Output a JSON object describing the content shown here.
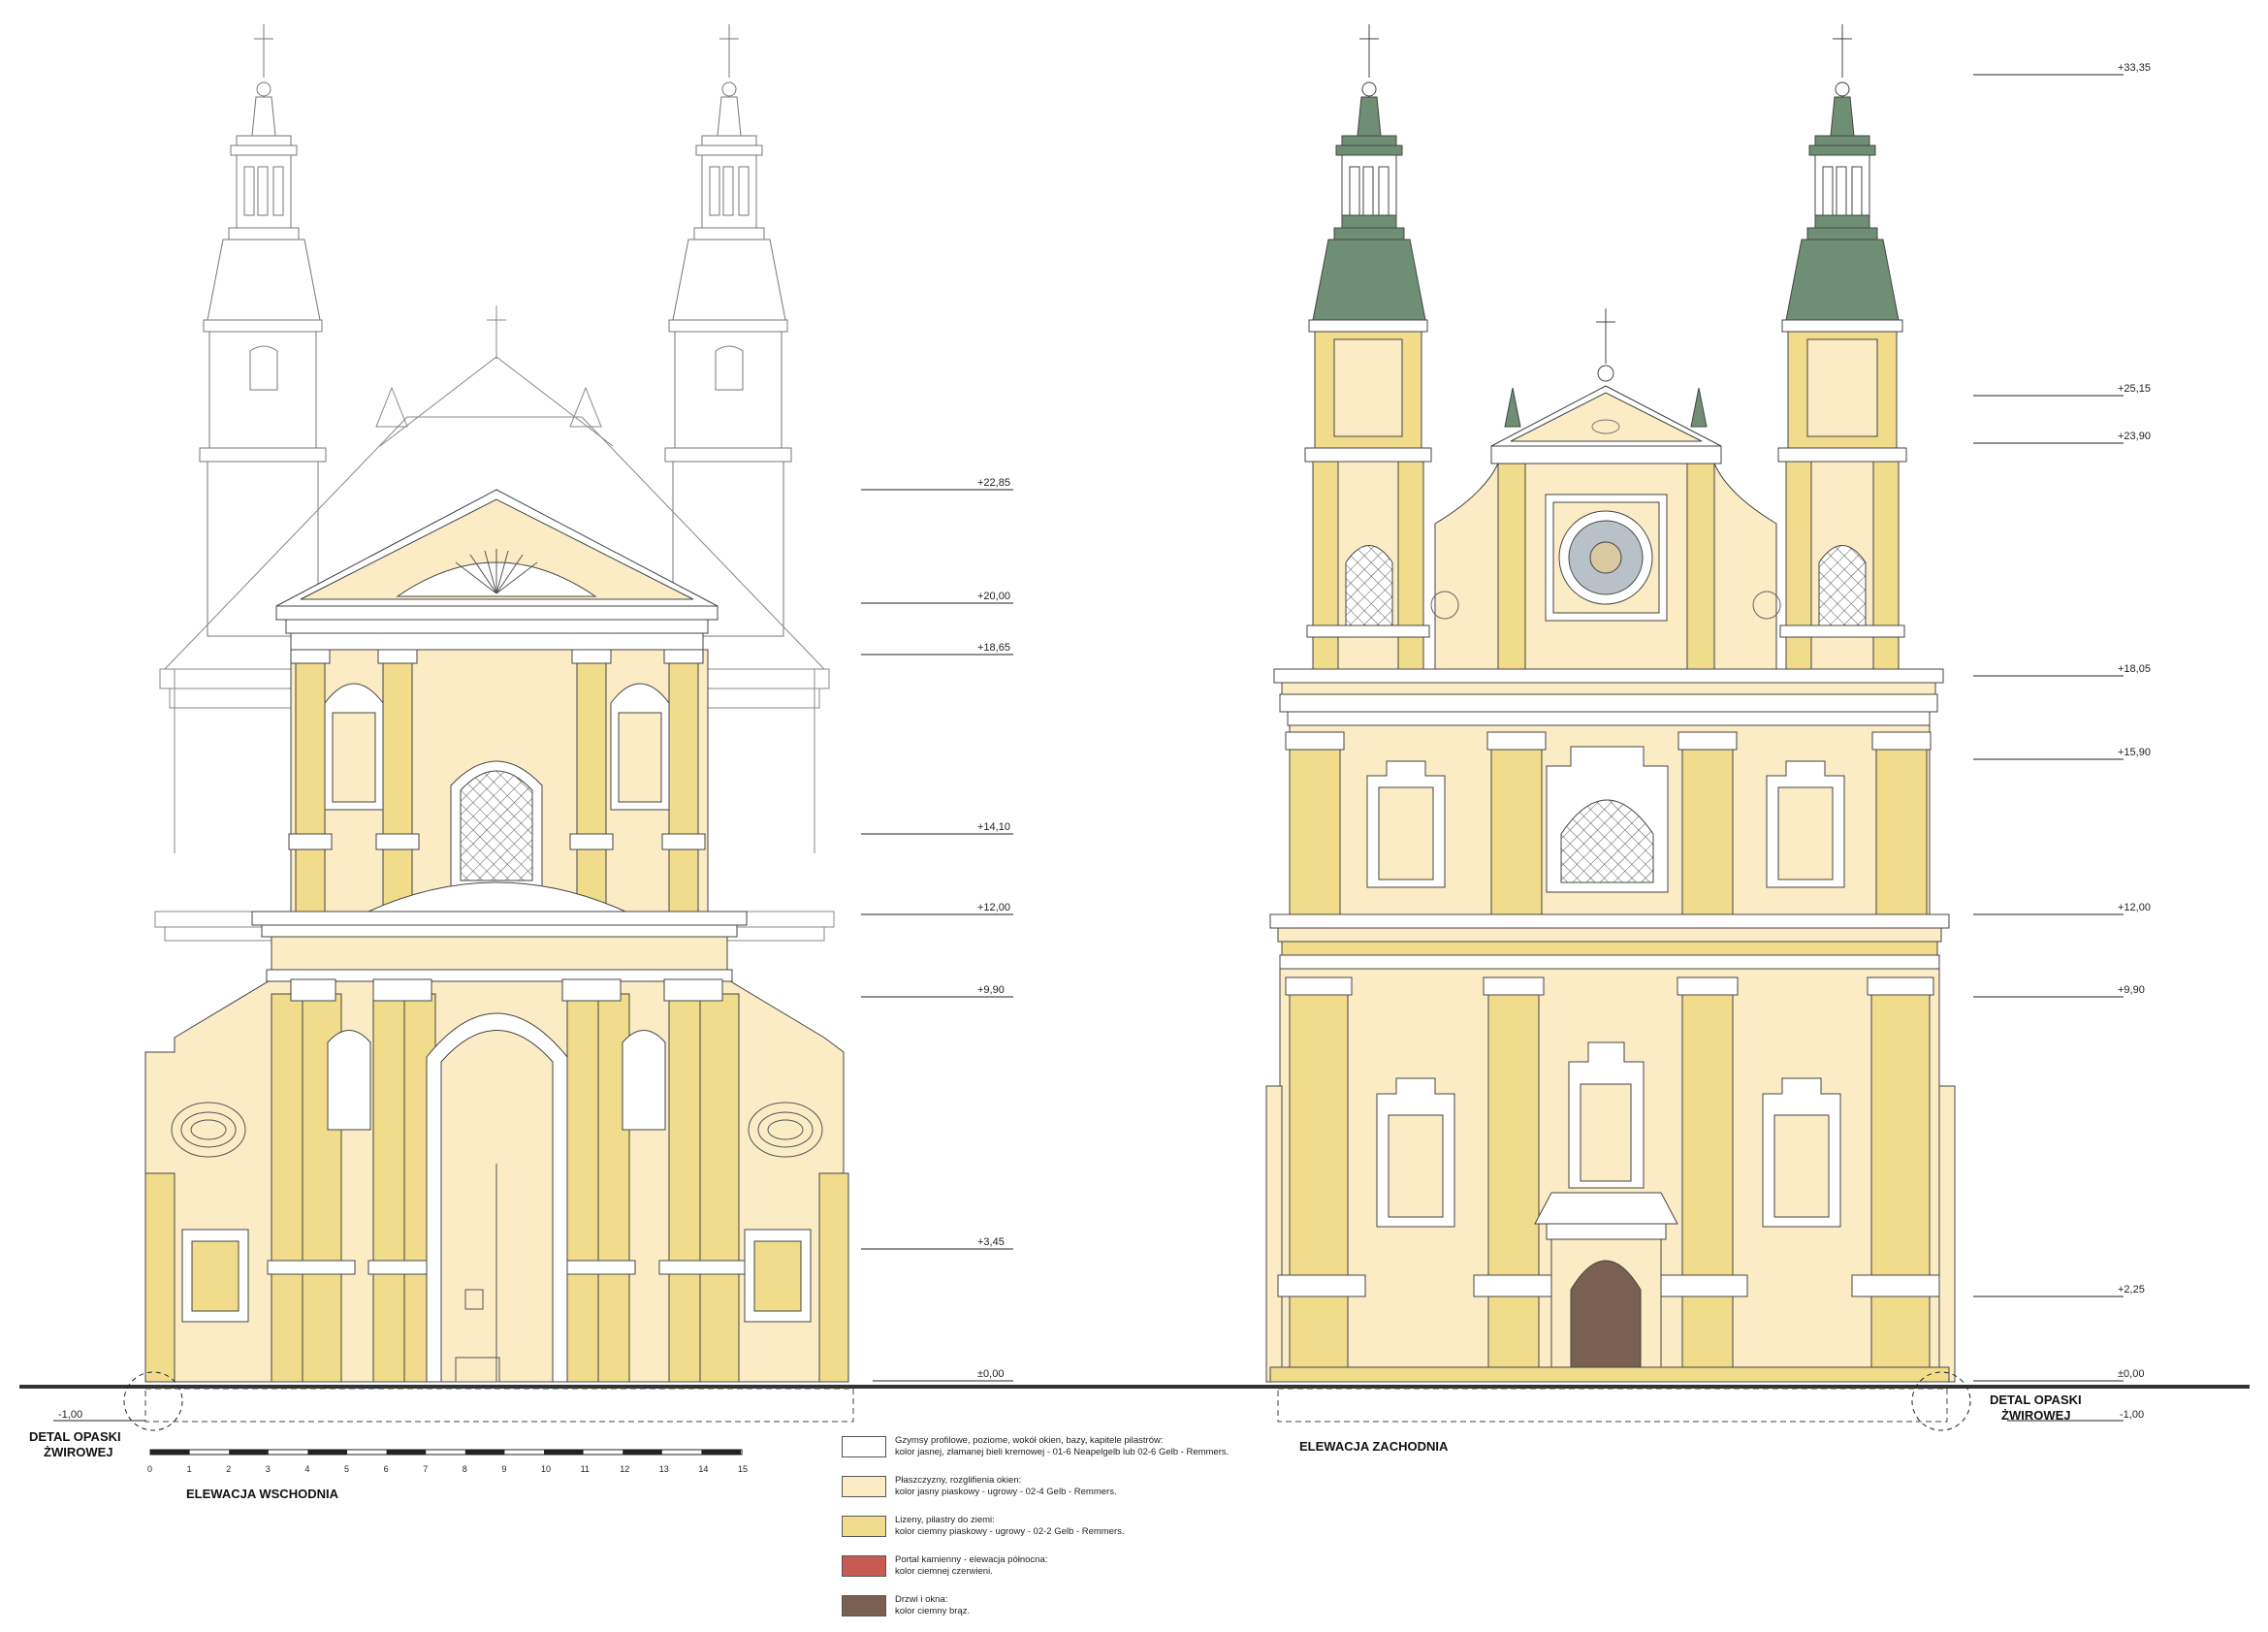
{
  "elevations": {
    "east": {
      "title": "ELEWACJA WSCHODNIA",
      "levels": [
        "+22,85",
        "+20,00",
        "+18,65",
        "+14,10",
        "+12,00",
        "+9,90",
        "+3,45",
        "±0,00"
      ],
      "ground_minus": "-1,00",
      "detail_label_1": "DETAL OPASKI",
      "detail_label_2": "ŻWIROWEJ"
    },
    "west": {
      "title": "ELEWACJA ZACHODNIA",
      "levels": [
        "+33,35",
        "+25,15",
        "+23,90",
        "+18,05",
        "+15,90",
        "+12,00",
        "+9,90",
        "+2,25",
        "±0,00"
      ],
      "ground_minus": "-1,00",
      "detail_label_1": "DETAL OPASKI",
      "detail_label_2": "ŻWIROWEJ"
    }
  },
  "scale_bar": {
    "ticks": [
      "0",
      "1",
      "2",
      "3",
      "4",
      "5",
      "6",
      "7",
      "8",
      "9",
      "10",
      "11",
      "12",
      "13",
      "14",
      "15"
    ]
  },
  "legend": [
    {
      "color": "#ffffff",
      "line1": "Gzymsy profilowe, poziome, wokół okien, bazy, kapitele pilastrów:",
      "line2": "kolor jasnej, złamanej bieli kremowej - 01-6 Neapelgelb lub 02-6 Gelb - Remmers."
    },
    {
      "color": "#fbecc6",
      "line1": "Płaszczyzny, rozglifienia okien:",
      "line2": "kolor jasny piaskowy - ugrowy - 02-4 Gelb - Remmers."
    },
    {
      "color": "#f1dc8c",
      "line1": "Lizeny, pilastry do ziemi:",
      "line2": "kolor ciemny piaskowy - ugrowy - 02-2 Gelb - Remmers."
    },
    {
      "color": "#c85a56",
      "line1": "Portal kamienny - elewacja północna:",
      "line2": "kolor ciemnej czerwieni."
    },
    {
      "color": "#7a6050",
      "line1": "Drzwi i okna:",
      "line2": "kolor ciemny brąz."
    }
  ],
  "colors": {
    "cream": "#fbecc6",
    "ochre": "#f1dc8c",
    "roof_green": "#6f8f74",
    "door_brown": "#7a6050",
    "line": "#333333"
  }
}
